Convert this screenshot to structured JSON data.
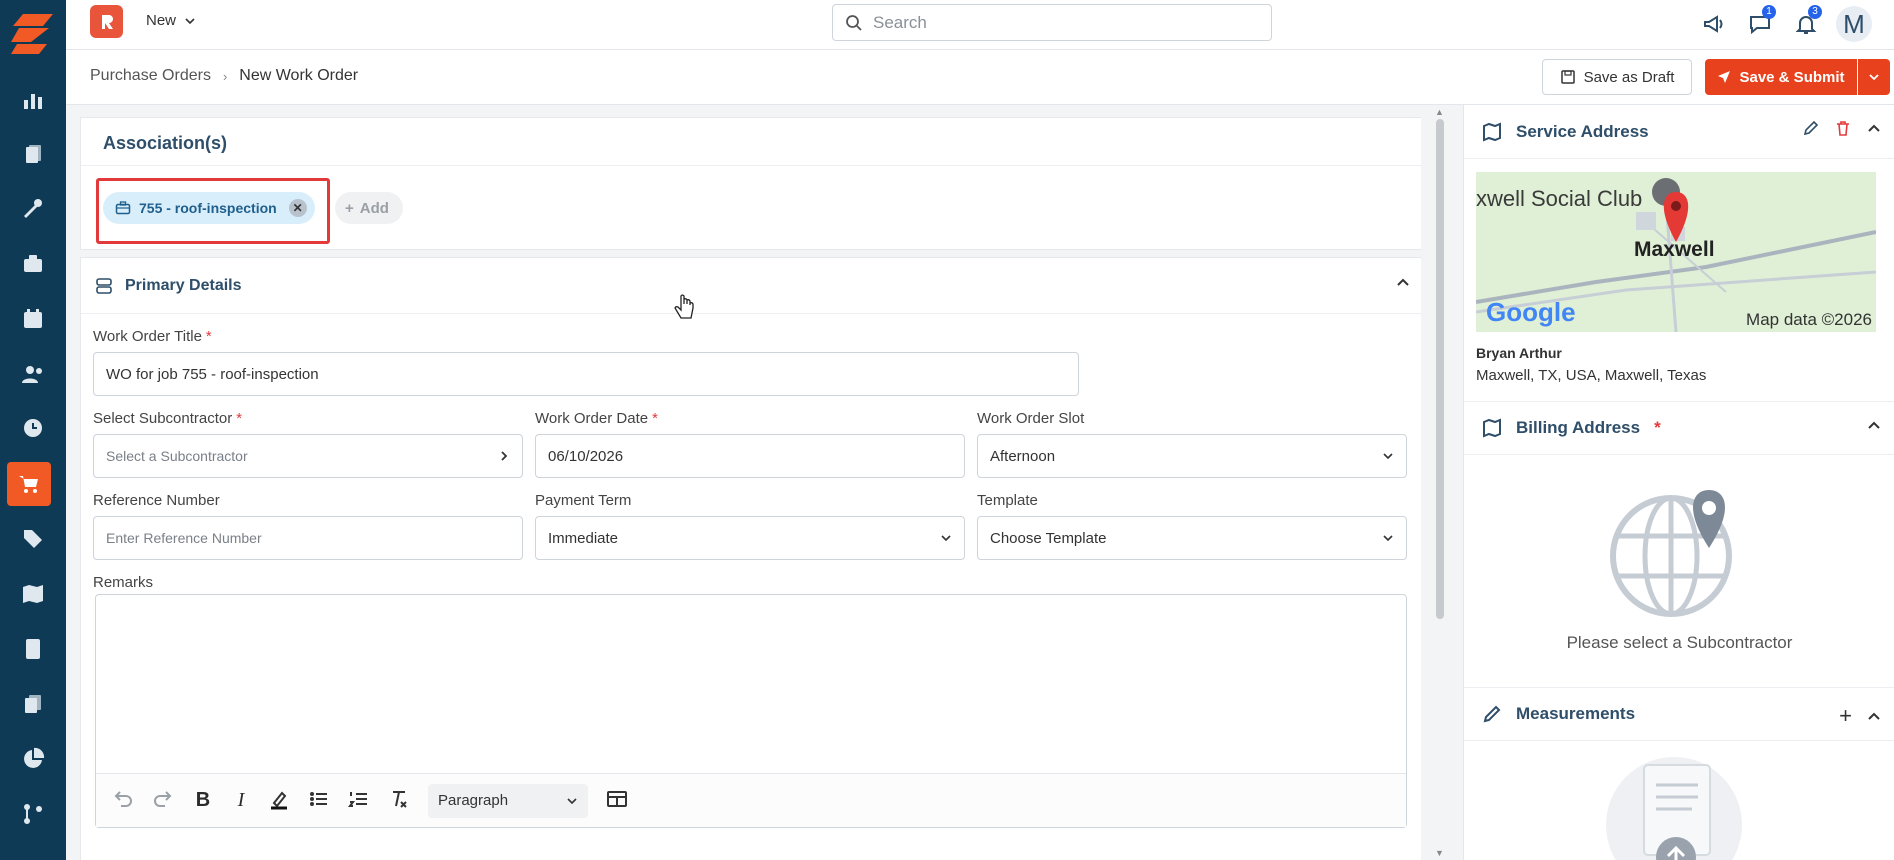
{
  "topbar": {
    "new_label": "New",
    "search_placeholder": "Search",
    "messages_count": "1",
    "notifications_count": "3",
    "avatar_initial": "M"
  },
  "breadcrumb": {
    "parent": "Purchase Orders",
    "current": "New Work Order"
  },
  "actions": {
    "save_draft": "Save as Draft",
    "save_submit": "Save & Submit"
  },
  "associations": {
    "title": "Association(s)",
    "chip_label": "755 - roof-inspection",
    "add_label": "Add"
  },
  "primary": {
    "title": "Primary Details",
    "wo_title_label": "Work Order Title",
    "wo_title_value": "WO for job 755 - roof-inspection",
    "subcontractor_label": "Select Subcontractor",
    "subcontractor_placeholder": "Select a Subcontractor",
    "wo_date_label": "Work Order Date",
    "wo_date_value": "06/10/2026",
    "wo_slot_label": "Work Order Slot",
    "wo_slot_value": "Afternoon",
    "ref_label": "Reference Number",
    "ref_placeholder": "Enter Reference Number",
    "payment_label": "Payment Term",
    "payment_value": "Immediate",
    "template_label": "Template",
    "template_value": "Choose Template",
    "remarks_label": "Remarks",
    "paragraph_value": "Paragraph"
  },
  "right": {
    "service_title": "Service Address",
    "map_place_1": "xwell Social Club",
    "map_place_2": "Maxwell",
    "map_google": "Google",
    "map_data": "Map data ©2026",
    "contact_name": "Bryan Arthur",
    "contact_address": "Maxwell, TX, USA, Maxwell, Texas",
    "billing_title": "Billing Address",
    "billing_empty": "Please select a Subcontractor",
    "measurements_title": "Measurements"
  },
  "colors": {
    "rail": "#0f3a55",
    "accent": "#f15a24",
    "submit": "#e8411d",
    "highlight": "#e23a3a",
    "heading": "#2e4e69"
  }
}
